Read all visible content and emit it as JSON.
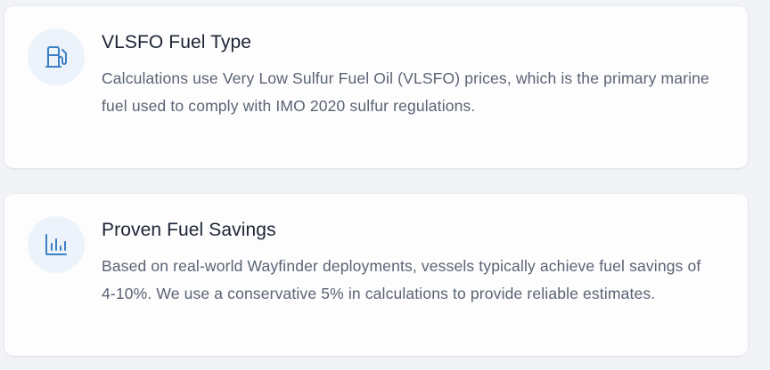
{
  "colors": {
    "page_background": "#f1f3f6",
    "card_background": "#fdfdfe",
    "icon_circle": "#ecf3fb",
    "icon_stroke": "#3d7fc4",
    "title_text": "#1c2433",
    "body_text": "#5a6372"
  },
  "cards": [
    {
      "icon": "fuel-pump-icon",
      "title": "VLSFO Fuel Type",
      "description": "Calculations use Very Low Sulfur Fuel Oil (VLSFO) prices, which is the primary marine fuel used to comply with IMO 2020 sulfur regulations."
    },
    {
      "icon": "bar-chart-icon",
      "title": "Proven Fuel Savings",
      "description": "Based on real-world Wayfinder deployments, vessels typically achieve fuel savings of 4-10%. We use a conservative 5% in calculations to provide reliable estimates."
    }
  ]
}
